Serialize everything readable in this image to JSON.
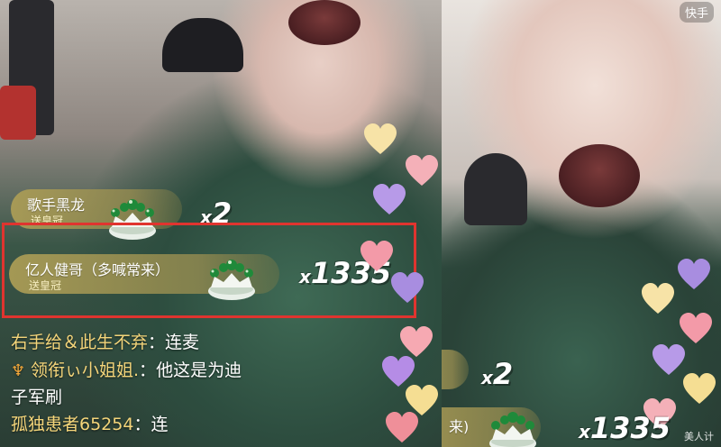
{
  "left_panel": {
    "gifts": [
      {
        "sender": "歌手黑龙",
        "action": "送皇冠",
        "combo_x": "x",
        "combo_count": "2"
      },
      {
        "sender": "亿人健哥（多喊常来）",
        "action": "送皇冠",
        "combo_x": "x",
        "combo_count": "1335"
      }
    ],
    "chat": [
      {
        "user": "右手给＆此生不弃",
        "sep": "：",
        "message": "连麦"
      },
      {
        "user": "领衔ぃ小姐姐.",
        "sep": "：",
        "message": "他这是为迪"
      },
      {
        "user": "",
        "sep": "",
        "message": "子军刷"
      },
      {
        "user": "孤独患者65254",
        "sep": "：",
        "message": "连"
      }
    ]
  },
  "right_panel": {
    "app_badge": "快手",
    "gift": {
      "sender_fragment": "来)",
      "combo_x": "x",
      "combo_count_2": "2",
      "combo_count_partial": "1335"
    },
    "watermark": "美人计"
  },
  "colors": {
    "highlight_border": "#e0342f",
    "gift_pill": "#ad9e56",
    "username": "#f4d57a"
  }
}
